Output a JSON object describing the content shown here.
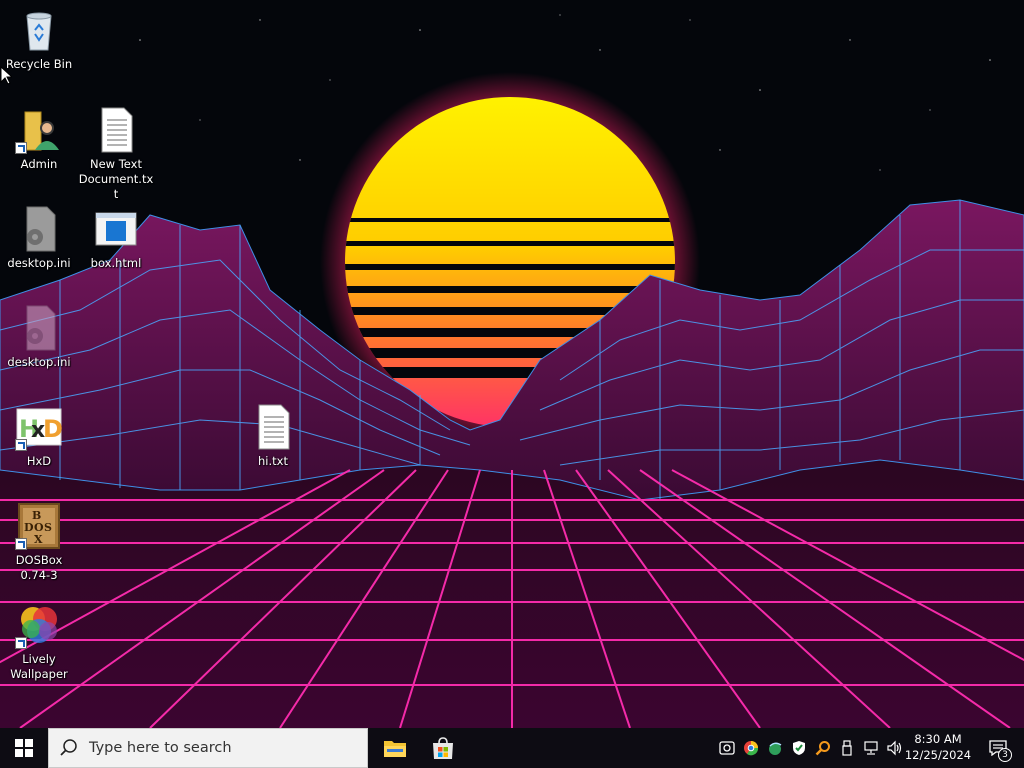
{
  "desktop_icons": {
    "recycle_bin": "Recycle Bin",
    "admin": "Admin",
    "new_text_doc": "New Text Document.txt",
    "desktop_ini_1": "desktop.ini",
    "box_html": "box.html",
    "desktop_ini_2": "desktop.ini",
    "hxd": "HxD",
    "hi_txt": "hi.txt",
    "dosbox": "DOSBox 0.74-3",
    "lively": "Lively Wallpaper"
  },
  "taskbar": {
    "search_placeholder": "Type here to search",
    "apps": [
      "file-explorer",
      "microsoft-store"
    ],
    "tray_icons": [
      "webcam-icon",
      "browser-icon",
      "network-globe-icon",
      "security-shield-icon",
      "search-magnifier-icon",
      "usb-device-icon",
      "network-icon",
      "volume-icon"
    ],
    "time": "8:30 AM",
    "date": "12/25/2024",
    "notification_count": "3"
  },
  "wallpaper": {
    "theme": "synthwave-sunset",
    "colors": {
      "sky": "#04060b",
      "sun_top": "#ffee00",
      "sun_bottom": "#ff3b6b",
      "grid_line": "#ff2db0",
      "mountain": "#5a0f4a",
      "mountain_line": "#4aa8ff"
    }
  }
}
